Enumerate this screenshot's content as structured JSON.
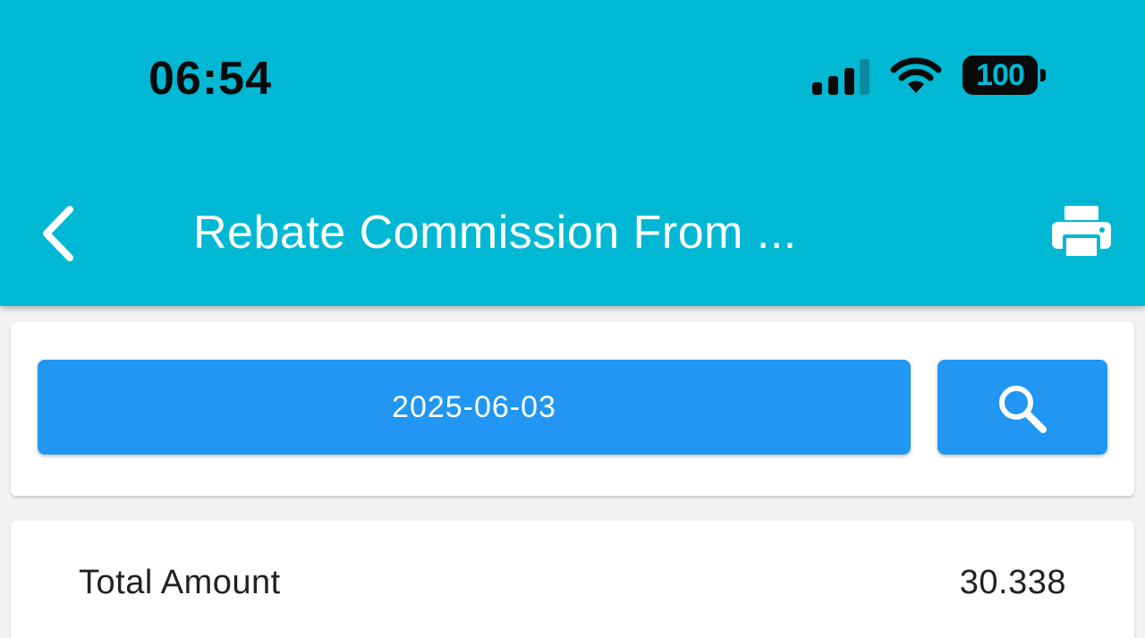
{
  "status_bar": {
    "time": "06:54",
    "battery": "100",
    "icons": [
      "signal-icon",
      "wifi-icon",
      "battery-icon"
    ]
  },
  "header": {
    "title": "Rebate Commission From ...",
    "back_icon": "chevron-left-icon",
    "print_icon": "printer-icon"
  },
  "filter": {
    "date": "2025-06-03",
    "search_icon": "search-icon"
  },
  "summary": {
    "total_label": "Total Amount",
    "total_value": "30.338"
  },
  "colors": {
    "header": "#00b8d4",
    "button": "#2196f3",
    "background": "#f2f2f2"
  }
}
